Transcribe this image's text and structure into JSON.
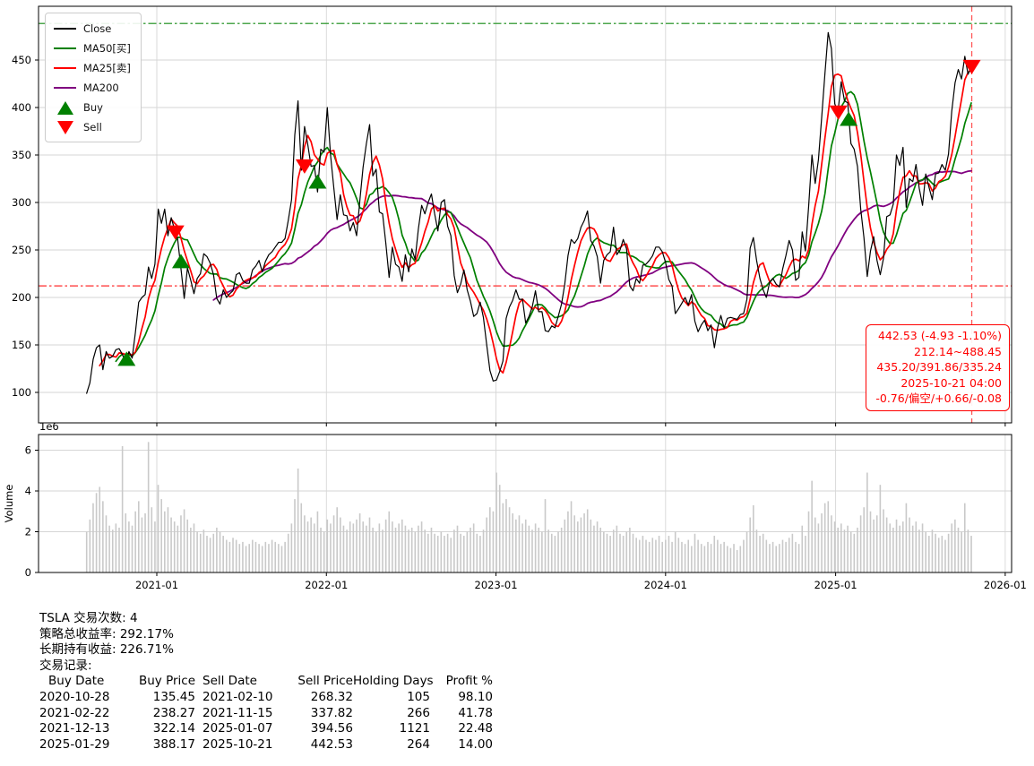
{
  "legend": {
    "items": [
      {
        "label": "Close",
        "color": "#000000",
        "type": "line"
      },
      {
        "label": "MA50[买]",
        "color": "#008000",
        "type": "line"
      },
      {
        "label": "MA25[卖]",
        "color": "#ff0000",
        "type": "line"
      },
      {
        "label": "MA200",
        "color": "#800080",
        "type": "line"
      },
      {
        "label": "Buy",
        "color": "#008000",
        "type": "triangle-up"
      },
      {
        "label": "Sell",
        "color": "#ff0000",
        "type": "triangle-down"
      }
    ]
  },
  "annotation": {
    "color": "#ff0000",
    "lines": [
      "442.53 (-4.93 -1.10%)",
      "212.14~488.45",
      "435.20/391.86/335.24",
      "2025-10-21 04:00",
      "-0.76/偏空/+0.66/-0.08"
    ]
  },
  "axes": {
    "y_ticks": [
      100,
      150,
      200,
      250,
      300,
      350,
      400,
      450
    ],
    "x_ticks": [
      {
        "label": "2021-01",
        "date": "2021-01-01"
      },
      {
        "label": "2022-01",
        "date": "2022-01-01"
      },
      {
        "label": "2023-01",
        "date": "2023-01-01"
      },
      {
        "label": "2024-01",
        "date": "2024-01-01"
      },
      {
        "label": "2025-01",
        "date": "2025-01-01"
      },
      {
        "label": "2026-01",
        "date": "2026-01-01"
      }
    ],
    "vol_ticks": [
      0,
      2,
      4,
      6
    ],
    "vol_offset_label": "1e6",
    "vol_ylabel": "Volume"
  },
  "chart_data": {
    "type": "line",
    "title": "",
    "xlabel": "",
    "ylabel": "",
    "ylim": [
      68,
      507
    ],
    "vol_ylim_millions": [
      0,
      6.77
    ],
    "x_range": [
      "2020-04-21",
      "2026-01-14"
    ],
    "start_date": "2020-08-03",
    "step_days": 7,
    "series": [
      {
        "name": "Close",
        "color": "#000000"
      },
      {
        "name": "MA50[买]",
        "color": "#008000",
        "window_weeks": 10
      },
      {
        "name": "MA25[卖]",
        "color": "#ff0000",
        "window_weeks": 5
      },
      {
        "name": "MA200",
        "color": "#800080",
        "window_weeks": 40
      }
    ],
    "close": [
      99,
      110,
      135,
      147,
      150,
      124,
      143,
      136,
      138,
      145,
      146,
      140,
      131,
      143,
      136,
      163,
      195,
      200,
      203,
      232,
      220,
      235,
      293,
      278,
      293,
      265,
      284,
      272,
      261,
      230,
      199,
      231,
      218,
      204,
      220,
      225,
      246,
      243,
      236,
      224,
      199,
      193,
      208,
      200,
      204,
      207,
      224,
      226,
      218,
      215,
      215,
      229,
      233,
      239,
      227,
      238,
      245,
      248,
      253,
      258,
      258,
      262,
      281,
      303,
      371,
      407,
      334,
      380,
      361,
      338,
      339,
      311,
      356,
      353,
      400,
      350,
      315,
      282,
      308,
      287,
      286,
      270,
      279,
      265,
      302,
      337,
      362,
      382,
      328,
      335,
      290,
      288,
      257,
      221,
      253,
      235,
      232,
      217,
      245,
      227,
      251,
      240,
      272,
      297,
      288,
      300,
      309,
      288,
      270,
      300,
      303,
      275,
      265,
      223,
      205,
      214,
      229,
      208,
      196,
      180,
      183,
      195,
      179,
      150,
      123,
      112,
      113,
      122,
      133,
      178,
      190,
      197,
      208,
      198,
      198,
      173,
      180,
      190,
      207,
      185,
      185,
      165,
      164,
      170,
      168,
      180,
      193,
      214,
      244,
      261,
      257,
      262,
      274,
      281,
      291,
      260,
      254,
      243,
      215,
      239,
      245,
      248,
      274,
      245,
      250,
      261,
      251,
      212,
      207,
      220,
      215,
      234,
      235,
      239,
      244,
      253,
      253,
      248,
      237,
      219,
      212,
      183,
      188,
      194,
      200,
      192,
      203,
      175,
      164,
      171,
      176,
      165,
      171,
      147,
      168,
      181,
      168,
      178,
      179,
      178,
      177,
      182,
      183,
      198,
      252,
      263,
      239,
      220,
      208,
      200,
      216,
      220,
      214,
      211,
      230,
      244,
      260,
      250,
      218,
      221,
      269,
      249,
      296,
      350,
      320,
      345,
      389,
      436,
      479,
      462,
      404,
      395,
      427,
      407,
      405,
      362,
      356,
      338,
      293,
      263,
      222,
      249,
      264,
      239,
      224,
      241,
      285,
      287,
      298,
      350,
      339,
      358,
      295,
      325,
      322,
      340,
      315,
      297,
      330,
      316,
      303,
      330,
      331,
      340,
      334,
      351,
      396,
      426,
      440,
      430,
      454,
      435,
      442.5
    ],
    "volume_millions": [
      2.0,
      2.6,
      3.4,
      3.9,
      4.2,
      3.5,
      2.8,
      2.3,
      2.1,
      2.4,
      2.2,
      6.2,
      2.9,
      2.5,
      2.3,
      3.0,
      3.5,
      2.7,
      2.9,
      6.4,
      3.2,
      2.5,
      4.3,
      3.6,
      3.0,
      3.2,
      2.7,
      2.5,
      2.3,
      2.8,
      3.1,
      2.6,
      2.2,
      2.4,
      2.0,
      1.9,
      2.1,
      1.8,
      1.7,
      1.9,
      2.2,
      2.0,
      1.8,
      1.6,
      1.5,
      1.7,
      1.6,
      1.4,
      1.5,
      1.3,
      1.4,
      1.6,
      1.5,
      1.4,
      1.3,
      1.5,
      1.4,
      1.6,
      1.5,
      1.4,
      1.3,
      1.5,
      1.9,
      2.4,
      3.6,
      5.1,
      3.4,
      2.8,
      2.5,
      2.7,
      2.4,
      3.0,
      2.2,
      2.0,
      2.6,
      2.4,
      2.8,
      3.2,
      2.7,
      2.3,
      2.1,
      2.5,
      2.4,
      2.6,
      2.9,
      2.5,
      2.3,
      2.7,
      2.2,
      2.0,
      2.4,
      2.1,
      2.6,
      3.0,
      2.5,
      2.2,
      2.4,
      2.6,
      2.3,
      2.1,
      2.2,
      2.0,
      2.3,
      2.5,
      2.1,
      1.9,
      2.2,
      1.9,
      1.8,
      2.0,
      1.8,
      1.9,
      1.7,
      2.1,
      2.3,
      1.9,
      1.8,
      2.0,
      2.2,
      2.4,
      1.9,
      1.8,
      2.1,
      2.7,
      3.2,
      3.0,
      4.9,
      4.3,
      3.4,
      3.6,
      3.2,
      2.9,
      2.6,
      2.8,
      2.4,
      2.6,
      2.3,
      2.1,
      2.4,
      2.2,
      2.0,
      3.6,
      2.1,
      1.9,
      1.8,
      2.0,
      2.2,
      2.6,
      3.0,
      3.5,
      2.8,
      2.5,
      2.7,
      2.9,
      3.1,
      2.6,
      2.3,
      2.5,
      2.2,
      2.0,
      1.9,
      1.8,
      2.1,
      2.3,
      1.9,
      1.8,
      2.0,
      2.2,
      1.9,
      1.7,
      1.6,
      1.8,
      1.6,
      1.5,
      1.7,
      1.6,
      1.8,
      1.5,
      1.6,
      1.8,
      1.5,
      2.0,
      1.7,
      1.5,
      1.4,
      1.6,
      1.3,
      1.9,
      1.6,
      1.4,
      1.3,
      1.5,
      1.4,
      1.8,
      1.6,
      1.4,
      1.5,
      1.3,
      1.2,
      1.4,
      1.1,
      1.3,
      1.6,
      2.0,
      2.7,
      3.3,
      2.1,
      1.8,
      1.9,
      1.6,
      1.4,
      1.5,
      1.3,
      1.4,
      1.6,
      1.5,
      1.7,
      1.9,
      1.5,
      1.4,
      2.3,
      1.8,
      3.0,
      4.5,
      2.7,
      2.4,
      2.9,
      3.4,
      3.5,
      2.8,
      2.5,
      2.2,
      2.4,
      2.1,
      2.3,
      2.0,
      1.9,
      2.2,
      2.8,
      3.2,
      4.9,
      3.0,
      2.6,
      2.8,
      4.3,
      3.1,
      2.7,
      2.4,
      2.2,
      2.6,
      2.3,
      2.5,
      3.4,
      2.7,
      2.3,
      2.5,
      2.1,
      2.4,
      2.0,
      1.8,
      2.1,
      1.9,
      1.7,
      1.8,
      1.6,
      1.9,
      2.4,
      2.6,
      2.2,
      2.0,
      3.4,
      2.1,
      1.8
    ],
    "reference_lines": {
      "high_value": 488.45,
      "high_color": "#3a9e3a",
      "low_value": 212.14,
      "low_color": "#ff3333",
      "vline_date": "2025-10-21",
      "vline_color": "#ff4444"
    },
    "trades": {
      "buys": [
        [
          "2020-10-28",
          135.45
        ],
        [
          "2021-02-22",
          238.27
        ],
        [
          "2021-12-13",
          322.14
        ],
        [
          "2025-01-29",
          388.17
        ]
      ],
      "sells": [
        [
          "2021-02-10",
          268.32
        ],
        [
          "2021-11-15",
          337.82
        ],
        [
          "2025-01-07",
          394.56
        ],
        [
          "2025-10-21",
          442.53
        ]
      ]
    }
  },
  "footer": {
    "line1": "TSLA 交易次数: 4",
    "line2": "策略总收益率: 292.17%",
    "line3": "长期持有收益: 226.71%",
    "line4": "交易记录:",
    "table_headers": [
      "Buy Date",
      "Buy Price",
      "Sell Date",
      "Sell Price",
      "Holding Days",
      "Profit %"
    ],
    "trades": [
      [
        "2020-10-28",
        "135.45",
        "2021-02-10",
        "268.32",
        "105",
        "98.10"
      ],
      [
        "2021-02-22",
        "238.27",
        "2021-11-15",
        "337.82",
        "266",
        "41.78"
      ],
      [
        "2021-12-13",
        "322.14",
        "2025-01-07",
        "394.56",
        "1121",
        "22.48"
      ],
      [
        "2025-01-29",
        "388.17",
        "2025-10-21",
        "442.53",
        "264",
        "14.00"
      ]
    ]
  }
}
